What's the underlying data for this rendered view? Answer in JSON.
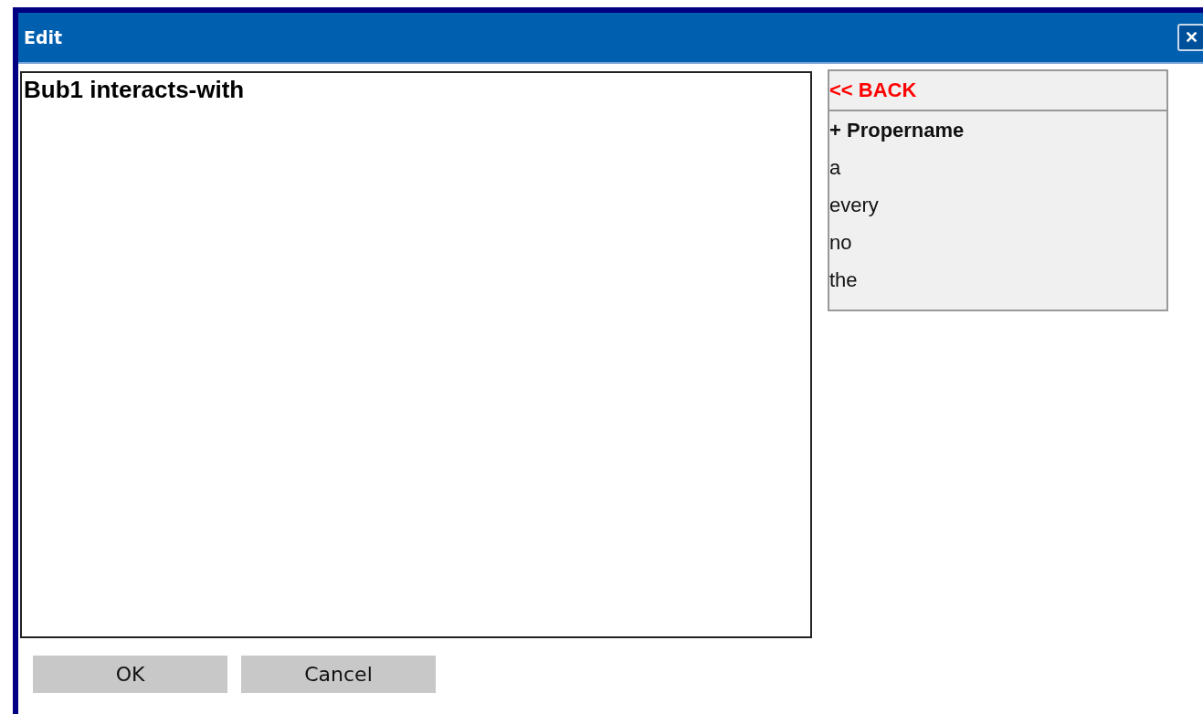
{
  "window": {
    "title": "Edit",
    "close": "✕"
  },
  "editor": {
    "text": "Bub1 interacts-with"
  },
  "menu": [
    {
      "kind": "back",
      "label": "<< BACK"
    },
    {
      "kind": "header",
      "label": "+ Propername"
    },
    {
      "kind": "option",
      "label": "a"
    },
    {
      "kind": "option",
      "label": "every"
    },
    {
      "kind": "option",
      "label": "no"
    },
    {
      "kind": "option",
      "label": "the"
    }
  ],
  "buttons": [
    "OK",
    "Cancel"
  ]
}
